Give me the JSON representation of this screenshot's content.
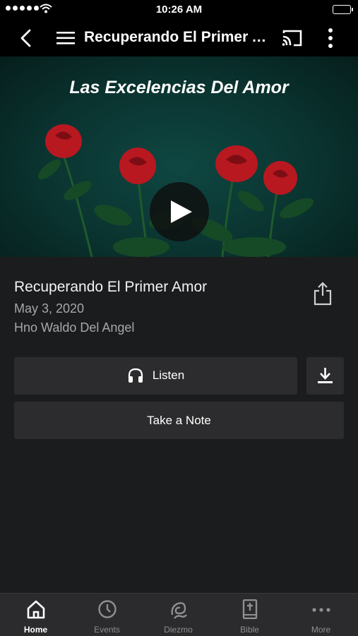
{
  "status_bar": {
    "time": "10:26 AM"
  },
  "nav": {
    "title": "Recuperando El Primer A..."
  },
  "hero": {
    "artwork_title": "Las Excelencias Del Amor"
  },
  "sermon": {
    "title": "Recuperando El Primer Amor",
    "date": "May 3, 2020",
    "speaker": "Hno Waldo Del Angel"
  },
  "actions": {
    "listen_label": "Listen",
    "note_label": "Take a Note"
  },
  "tabs": [
    {
      "label": "Home",
      "icon": "home-icon",
      "active": true
    },
    {
      "label": "Events",
      "icon": "clock-icon",
      "active": false
    },
    {
      "label": "Diezmo",
      "icon": "diezmo-icon",
      "active": false
    },
    {
      "label": "Bible",
      "icon": "bible-icon",
      "active": false
    },
    {
      "label": "More",
      "icon": "more-dots-icon",
      "active": false
    }
  ],
  "colors": {
    "background": "#1b1c1e",
    "bar": "#000000",
    "button": "#2c2c2e",
    "tab_inactive": "#8e8e93",
    "rose": "#b81820"
  }
}
